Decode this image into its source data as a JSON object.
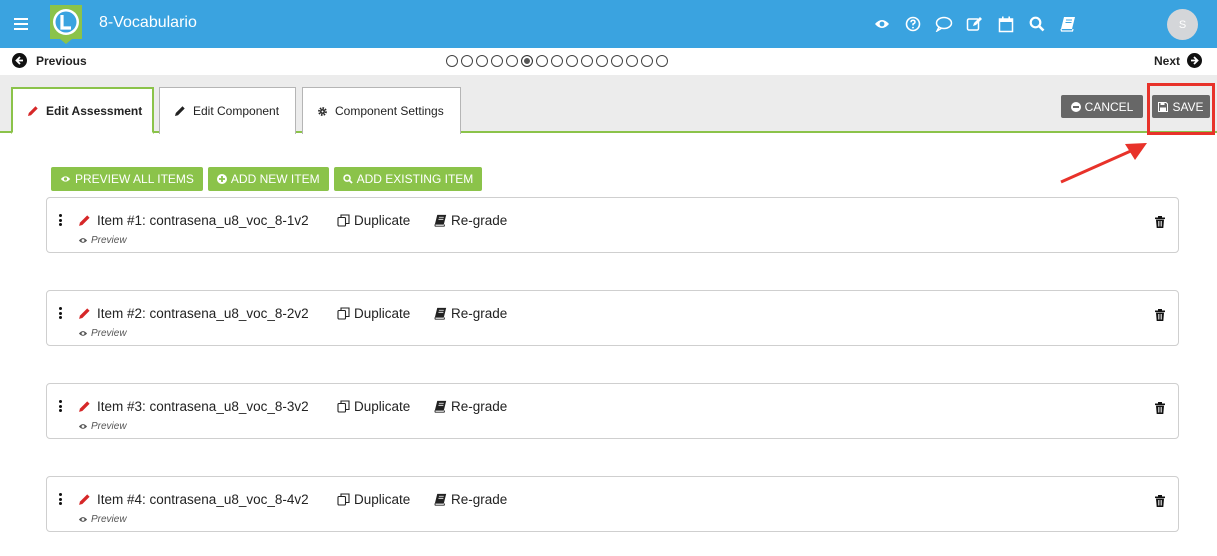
{
  "app": {
    "title": "8-Vocabulario",
    "avatar_initial": "S",
    "brand_color": "#3aa3e0",
    "accent_color": "#8bc34a"
  },
  "top_icons": [
    "eye-icon",
    "help-icon",
    "comment-icon",
    "edit-icon",
    "calendar-icon",
    "search-icon",
    "book-icon"
  ],
  "nav": {
    "previous_label": "Previous",
    "next_label": "Next",
    "total_pages": 15,
    "current_page": 6
  },
  "tabs": [
    {
      "label": "Edit Assessment",
      "icon": "pencil-icon",
      "active": true
    },
    {
      "label": "Edit Component",
      "icon": "pencil-icon",
      "active": false
    },
    {
      "label": "Component Settings",
      "icon": "gear-icon",
      "active": false
    }
  ],
  "buttons": {
    "cancel_label": "CANCEL",
    "save_label": "SAVE"
  },
  "actions": {
    "preview_all": "PREVIEW ALL ITEMS",
    "add_new": "ADD NEW ITEM",
    "add_existing": "ADD EXISTING ITEM"
  },
  "items": [
    {
      "title": "Item #1: contrasena_u8_voc_8-1v2",
      "duplicate": "Duplicate",
      "regrade": "Re-grade",
      "preview": "Preview"
    },
    {
      "title": "Item #2: contrasena_u8_voc_8-2v2",
      "duplicate": "Duplicate",
      "regrade": "Re-grade",
      "preview": "Preview"
    },
    {
      "title": "Item #3: contrasena_u8_voc_8-3v2",
      "duplicate": "Duplicate",
      "regrade": "Re-grade",
      "preview": "Preview"
    },
    {
      "title": "Item #4: contrasena_u8_voc_8-4v2",
      "duplicate": "Duplicate",
      "regrade": "Re-grade",
      "preview": "Preview"
    }
  ]
}
